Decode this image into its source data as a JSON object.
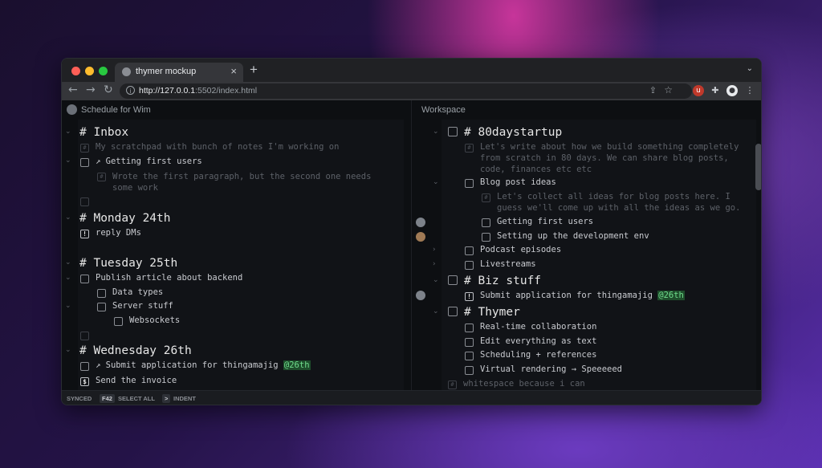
{
  "browser": {
    "tab_title": "thymer mockup",
    "tab_close": "×",
    "new_tab": "+",
    "url_host": "http://127.0.0.1",
    "url_path": ":5502/index.html"
  },
  "left_pane": {
    "header": "Schedule for Wim",
    "sections": {
      "inbox": {
        "title": "# Inbox",
        "note": "My scratchpad with bunch of notes I'm working on",
        "item1": "↗ Getting first users",
        "item1_note_a": "Wrote the first paragraph, but the second one needs",
        "item1_note_b": "some work"
      },
      "monday": {
        "title": "# Monday 24th",
        "item1": "reply DMs"
      },
      "tuesday": {
        "title": "# Tuesday 25th",
        "item1": "Publish article about backend",
        "item2": "Data types",
        "item3": "Server stuff",
        "item4": "Websockets"
      },
      "wednesday": {
        "title": "# Wednesday 26th",
        "item1": "↗ Submit application for thingamajig",
        "item1_tag": "@26th",
        "item2": "Send the invoice"
      }
    }
  },
  "right_pane": {
    "header": "Workspace",
    "sections": {
      "startup": {
        "title": "# 80daystartup",
        "note_a": "Let's write about how we build something completely",
        "note_b": "from scratch in 80 days. We can share blog posts,",
        "note_c": "code, finances etc etc",
        "blog": "Blog post ideas",
        "blog_note_a": "Let's collect all ideas for blog posts here. I",
        "blog_note_b": "guess we'll come up with all the ideas as we go.",
        "blog_item1": "Getting first users",
        "blog_item2": "Setting up the development env",
        "podcast": "Podcast episodes",
        "livestreams": "Livestreams"
      },
      "biz": {
        "title": "# Biz stuff",
        "item1": "Submit application for thingamajig",
        "item1_tag": "@26th"
      },
      "thymer": {
        "title": "# Thymer",
        "item1": "Real-time collaboration",
        "item2": "Edit everything as text",
        "item3": "Scheduling + references",
        "item4": "Virtual rendering → Speeeeed"
      },
      "whitespace": "whitespace because i can"
    }
  },
  "status_bar": {
    "synced": "SYNCED",
    "key1": "F42",
    "action1": "SELECT ALL",
    "key2": ">",
    "action2": "INDENT"
  },
  "colors": {
    "background": "#0d0f12",
    "tag_bg": "#1e4d2b",
    "tag_fg": "#6fdc8c"
  }
}
